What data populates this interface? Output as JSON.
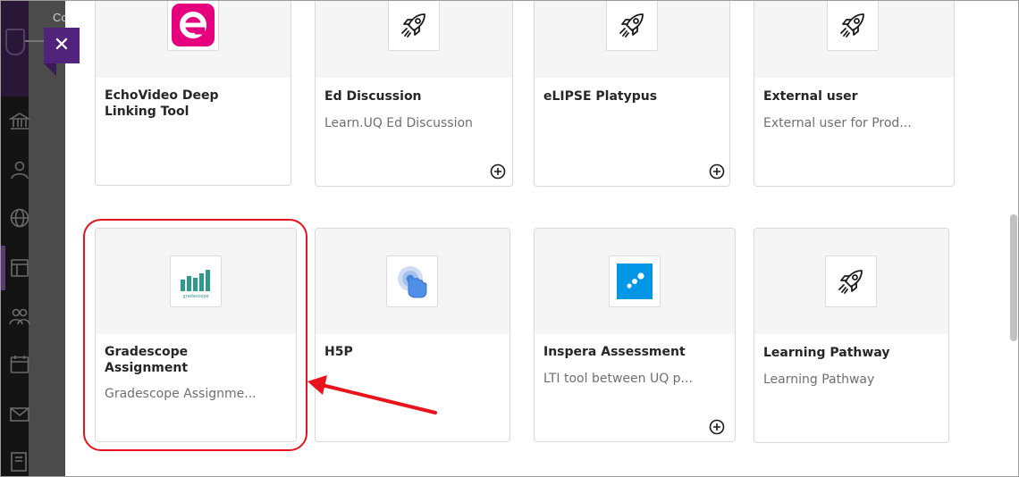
{
  "background_nav": {
    "partial_label": "Co",
    "icons": [
      "institution-icon",
      "user-icon",
      "globe-icon",
      "courses-icon",
      "groups-icon",
      "calendar-icon",
      "mail-icon",
      "grades-icon"
    ]
  },
  "close_button": {
    "glyph": "✕"
  },
  "tools": [
    {
      "title_line1": "EchoVideo Deep",
      "title_line2": "Linking Tool",
      "description": "",
      "icon": "echovideo-logo-icon",
      "has_add": false
    },
    {
      "title_line1": "Ed Discussion",
      "title_line2": "",
      "description": "Learn.UQ Ed Discussion",
      "icon": "rocket-icon",
      "has_add": true
    },
    {
      "title_line1": "eLIPSE Platypus",
      "title_line2": "",
      "description": "",
      "icon": "rocket-icon",
      "has_add": true
    },
    {
      "title_line1": "External user",
      "title_line2": "",
      "description": "External user for Prod...",
      "icon": "rocket-icon",
      "has_add": false
    },
    {
      "title_line1": "Gradescope",
      "title_line2": "Assignment",
      "description": "Gradescope Assignme...",
      "icon": "gradescope-logo-icon",
      "logo_text": "gradescope",
      "has_add": false
    },
    {
      "title_line1": "H5P",
      "title_line2": "",
      "description": "",
      "icon": "h5p-touch-icon",
      "has_add": false
    },
    {
      "title_line1": "Inspera Assessment",
      "title_line2": "",
      "description": "LTI tool between UQ p...",
      "icon": "inspera-logo-icon",
      "has_add": true
    },
    {
      "title_line1": "Learning Pathway",
      "title_line2": "",
      "description": "Learning Pathway",
      "icon": "rocket-icon",
      "has_add": false
    }
  ],
  "colors": {
    "accent_purple": "#51237a",
    "annotation_red": "#e8131b",
    "echo_pink": "#e6007e",
    "gradescope_teal": "#2e9a8c",
    "inspera_blue": "#0096e6",
    "h5p_blue": "#4f8fe8"
  }
}
